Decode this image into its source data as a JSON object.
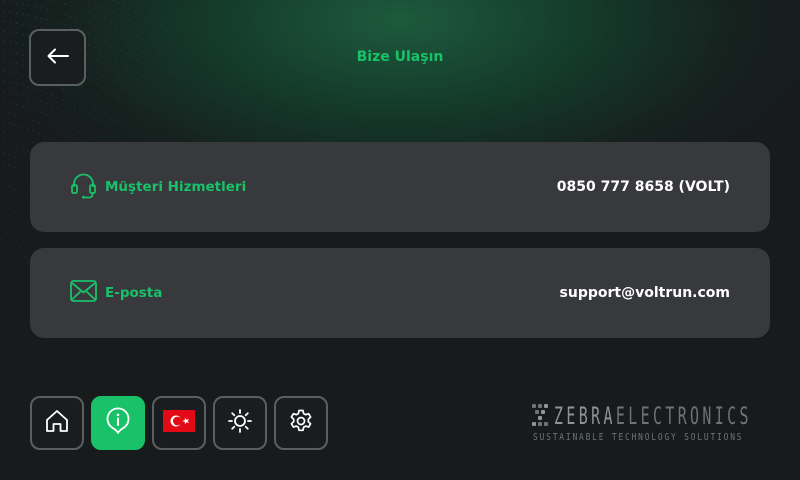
{
  "header": {
    "title": "Bize Ulaşın",
    "back_icon": "arrow-left-icon"
  },
  "contacts": [
    {
      "icon": "headset-icon",
      "label": "Müşteri Hizmetleri",
      "value": "0850 777 8658 (VOLT)"
    },
    {
      "icon": "envelope-icon",
      "label": "E-posta",
      "value": "support@voltrun.com"
    }
  ],
  "nav": {
    "items": [
      {
        "icon": "home-icon",
        "active": false
      },
      {
        "icon": "info-icon",
        "active": true
      },
      {
        "icon": "turkey-flag-icon",
        "active": false
      },
      {
        "icon": "brightness-icon",
        "active": false
      },
      {
        "icon": "gear-icon",
        "active": false
      }
    ]
  },
  "brand": {
    "name_part1": "ZEBRA",
    "name_part2": "ELECTRONICS",
    "tagline": "SUSTAINABLE TECHNOLOGY SOLUTIONS"
  },
  "colors": {
    "accent": "#19c169",
    "card": "#38393d",
    "background": "#171b1c"
  }
}
